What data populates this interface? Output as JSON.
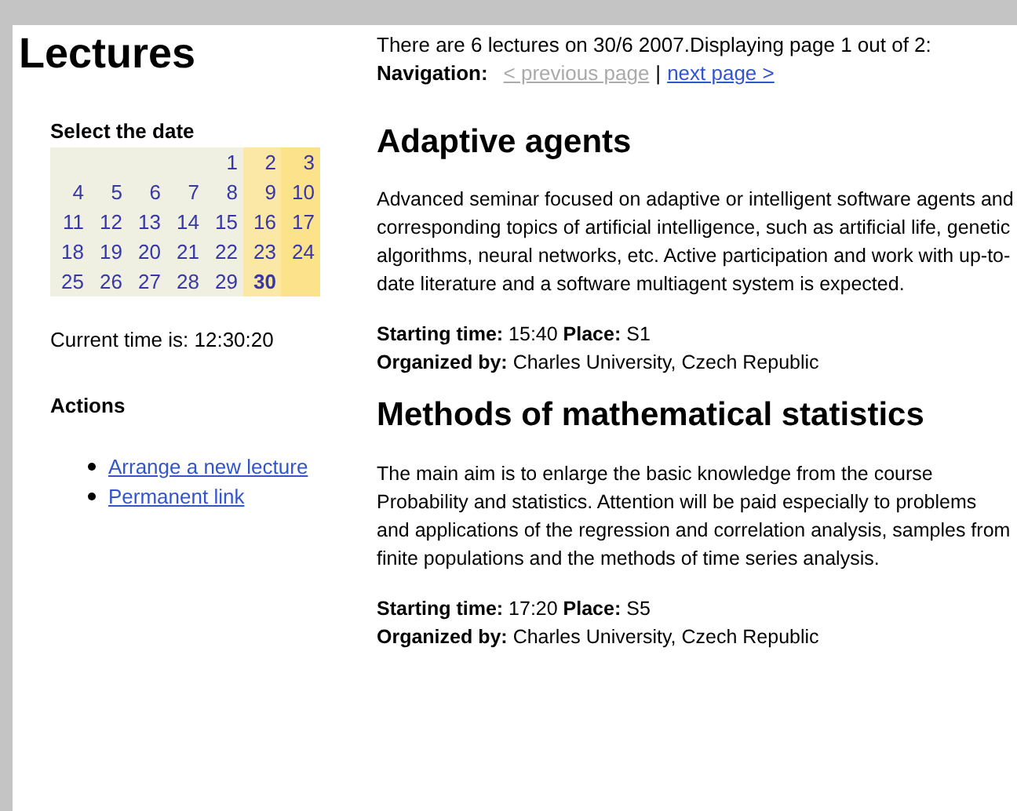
{
  "page_title": "Lectures",
  "calendar": {
    "title": "Select the date",
    "weeks": [
      [
        {
          "kind": "blank"
        },
        {
          "kind": "blank"
        },
        {
          "kind": "blank"
        },
        {
          "kind": "blank"
        },
        {
          "kind": "day",
          "label": "1",
          "selected": false
        },
        {
          "kind": "day",
          "label": "2",
          "selected": false
        },
        {
          "kind": "day",
          "label": "3",
          "selected": false
        }
      ],
      [
        {
          "kind": "day",
          "label": "4",
          "selected": false
        },
        {
          "kind": "day",
          "label": "5",
          "selected": false
        },
        {
          "kind": "day",
          "label": "6",
          "selected": false
        },
        {
          "kind": "day",
          "label": "7",
          "selected": false
        },
        {
          "kind": "day",
          "label": "8",
          "selected": false
        },
        {
          "kind": "day",
          "label": "9",
          "selected": false
        },
        {
          "kind": "day",
          "label": "10",
          "selected": false
        }
      ],
      [
        {
          "kind": "day",
          "label": "11",
          "selected": false
        },
        {
          "kind": "day",
          "label": "12",
          "selected": false
        },
        {
          "kind": "day",
          "label": "13",
          "selected": false
        },
        {
          "kind": "day",
          "label": "14",
          "selected": false
        },
        {
          "kind": "day",
          "label": "15",
          "selected": false
        },
        {
          "kind": "day",
          "label": "16",
          "selected": false
        },
        {
          "kind": "day",
          "label": "17",
          "selected": false
        }
      ],
      [
        {
          "kind": "day",
          "label": "18",
          "selected": false
        },
        {
          "kind": "day",
          "label": "19",
          "selected": false
        },
        {
          "kind": "day",
          "label": "20",
          "selected": false
        },
        {
          "kind": "day",
          "label": "21",
          "selected": false
        },
        {
          "kind": "day",
          "label": "22",
          "selected": false
        },
        {
          "kind": "day",
          "label": "23",
          "selected": false
        },
        {
          "kind": "day",
          "label": "24",
          "selected": false
        }
      ],
      [
        {
          "kind": "day",
          "label": "25",
          "selected": false
        },
        {
          "kind": "day",
          "label": "26",
          "selected": false
        },
        {
          "kind": "day",
          "label": "27",
          "selected": false
        },
        {
          "kind": "day",
          "label": "28",
          "selected": false
        },
        {
          "kind": "day",
          "label": "29",
          "selected": false
        },
        {
          "kind": "day",
          "label": "30",
          "selected": true
        },
        {
          "kind": "blank"
        }
      ]
    ]
  },
  "current_time": "Current time is: 12:30:20",
  "actions": {
    "title": "Actions",
    "links": [
      "Arrange a new lecture",
      "Permanent link"
    ]
  },
  "summary": "There are 6 lectures on 30/6 2007.Displaying page 1 out of 2:",
  "navigation": {
    "label": "Navigation:",
    "separator": "|",
    "links": [
      {
        "label": "< previous page",
        "disabled": true
      },
      {
        "label": "next page >",
        "disabled": false
      }
    ]
  },
  "lectures": [
    {
      "title": "Adaptive agents",
      "description": "Advanced seminar focused on adaptive or intelligent software agents and corresponding topics of artificial intelligence, such as artificial life, genetic algorithms, neural networks, etc. Active participation and work with up-to-date literature and a software multiagent system is expected.",
      "details": [
        "**Starting time:** 15:40 **Place:** S1",
        "**Organized by:** Charles University, Czech Republic"
      ]
    },
    {
      "title": "Methods of mathematical statistics",
      "description": "The main aim is to enlarge the basic knowledge from the course Probability and statistics. Attention will be paid especially to problems and applications of the regression and correlation analysis, samples from finite populations and the methods of time series analysis.",
      "details": [
        "**Starting time:** 17:20 **Place:** S5",
        "**Organized by:** Charles University, Czech Republic"
      ]
    }
  ]
}
